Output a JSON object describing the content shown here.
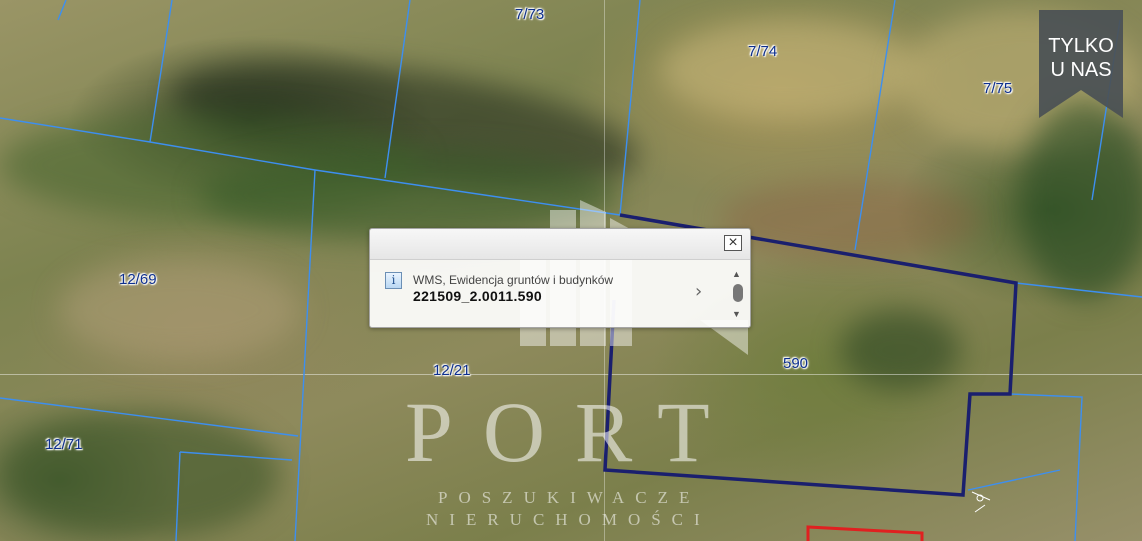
{
  "map": {
    "parcel_labels": [
      {
        "id": "label-7-73",
        "text": "7/73"
      },
      {
        "id": "label-7-74",
        "text": "7/74"
      },
      {
        "id": "label-7-75",
        "text": "7/75"
      },
      {
        "id": "label-12-69",
        "text": "12/69"
      },
      {
        "id": "label-12-21",
        "text": "12/21"
      },
      {
        "id": "label-590",
        "text": "590"
      },
      {
        "id": "label-12-71",
        "text": "12/71"
      }
    ],
    "colors": {
      "parcel_line": "#3d8ff0",
      "selected_outline": "#1a1f6e",
      "red_outline": "#e02020"
    }
  },
  "badge": {
    "line1": "TYLKO",
    "line2": "U NAS",
    "color": "#4a5055"
  },
  "watermark": {
    "title": "PORT",
    "sub1": "POSZUKIWACZE",
    "sub2": "NIERUCHOMOŚCI"
  },
  "popup": {
    "icon": "info-icon",
    "layer_name": "WMS, Ewidencja gruntów i budynków",
    "feature_id": "221509_2.0011.590",
    "close_icon": "close-icon",
    "next_icon": "chevron-right-icon"
  }
}
